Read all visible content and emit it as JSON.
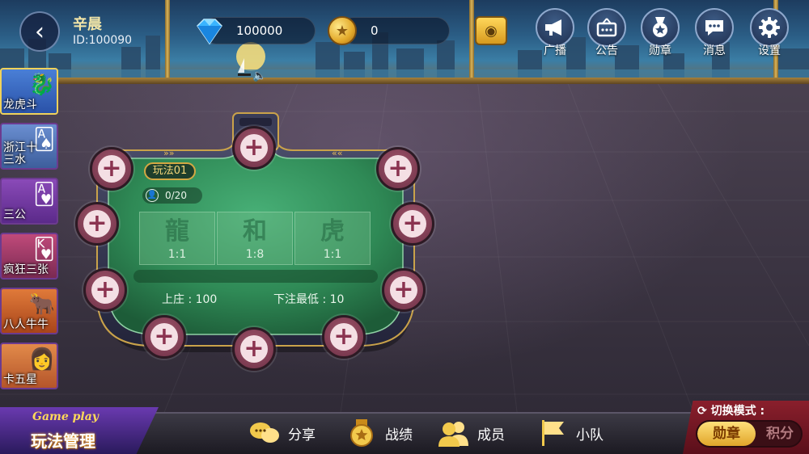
{
  "header": {
    "user_name": "辛晨",
    "user_id": "ID:100090",
    "diamonds": "100000",
    "coins": "0",
    "buttons": [
      {
        "icon": "broadcast-icon",
        "label": "广播"
      },
      {
        "icon": "notice-icon",
        "label": "公告"
      },
      {
        "icon": "medal-icon",
        "label": "勋章"
      },
      {
        "icon": "message-icon",
        "label": "消息"
      },
      {
        "icon": "gear-icon",
        "label": "设置"
      }
    ]
  },
  "sidebar": {
    "items": [
      {
        "label": "龙虎斗",
        "selected": true
      },
      {
        "label": "浙江十三水"
      },
      {
        "label": "三公"
      },
      {
        "label": "疯狂三张"
      },
      {
        "label": "八人牛牛"
      },
      {
        "label": "卡五星"
      }
    ]
  },
  "table": {
    "tag": "玩法01",
    "player_count": "0/20",
    "bets": [
      {
        "name": "龍",
        "odds": "1:1"
      },
      {
        "name": "和",
        "odds": "1:8"
      },
      {
        "name": "虎",
        "odds": "1:1"
      }
    ],
    "banker_label": "上庄 : 100",
    "min_bet_label": "下注最低 : 10",
    "seat_symbol": "+"
  },
  "bottom": {
    "manage_sub": "Game play",
    "manage_main": "玩法管理",
    "items": [
      {
        "icon": "share-icon",
        "label": "分享"
      },
      {
        "icon": "record-icon",
        "label": "战绩"
      },
      {
        "icon": "members-icon",
        "label": "成员"
      },
      {
        "icon": "team-flag-icon",
        "label": "小队"
      }
    ],
    "mode_label": "切换模式 :",
    "mode_on": "勋章",
    "mode_off": "积分"
  },
  "colors": {
    "table_felt": "#2f8a56",
    "seat": "#8b3e58",
    "gold": "#d3a843"
  }
}
